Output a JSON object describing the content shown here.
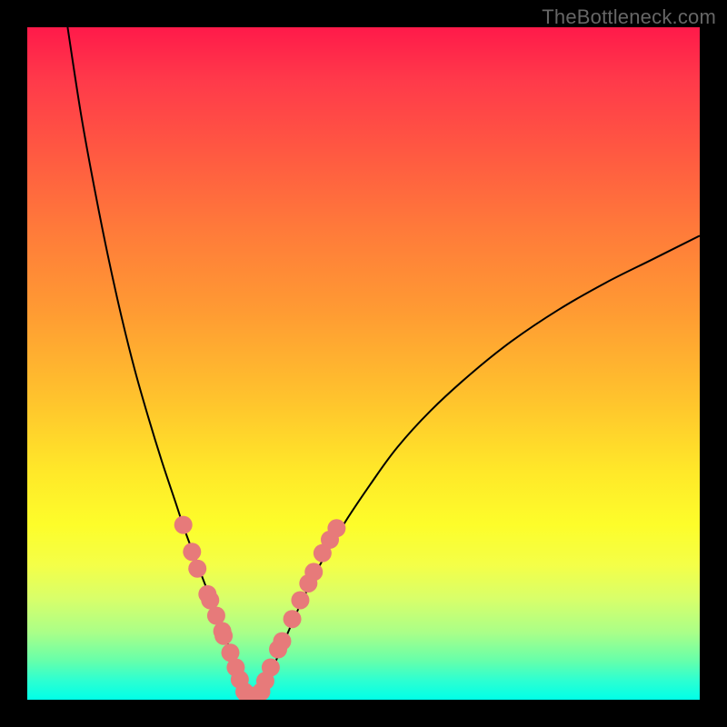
{
  "watermark": "TheBottleneck.com",
  "chart_data": {
    "type": "line",
    "title": "",
    "xlabel": "",
    "ylabel": "",
    "ylim": [
      0,
      100
    ],
    "xlim": [
      0,
      100
    ],
    "series": [
      {
        "name": "curve-left",
        "x": [
          6,
          8,
          10,
          12,
          14,
          16,
          18,
          20,
          22,
          23.5,
          25,
          26.5,
          28,
          29,
          30,
          30.8,
          31.5,
          32.1
        ],
        "values": [
          100,
          87,
          76,
          66,
          57,
          49,
          42,
          35.5,
          29.5,
          25,
          21,
          17,
          13.5,
          10.5,
          7.8,
          5.3,
          3.2,
          1.2
        ]
      },
      {
        "name": "curve-right",
        "x": [
          35,
          36,
          37.5,
          39.2,
          41,
          43.5,
          47,
          51,
          55,
          60,
          66,
          72,
          79,
          86,
          93,
          100
        ],
        "values": [
          1.2,
          3.5,
          7,
          11,
          15,
          20,
          26,
          32,
          37.5,
          43,
          48.5,
          53.3,
          58,
          62,
          65.5,
          69
        ]
      },
      {
        "name": "dots-left",
        "type": "scatter",
        "x": [
          23.2,
          24.5,
          25.3,
          26.8,
          27.2,
          28.1,
          29.0,
          29.2,
          30.2,
          31.0,
          31.6,
          32.3
        ],
        "values": [
          26.0,
          22.0,
          19.5,
          15.7,
          14.8,
          12.5,
          10.2,
          9.5,
          7.0,
          4.8,
          3.0,
          1.2
        ]
      },
      {
        "name": "dots-right",
        "type": "scatter",
        "x": [
          34.8,
          35.4,
          36.2,
          37.3,
          37.9,
          39.4,
          40.6,
          41.8,
          42.6,
          43.9,
          45.0,
          46.0
        ],
        "values": [
          1.2,
          2.8,
          4.8,
          7.5,
          8.7,
          12.0,
          14.8,
          17.3,
          19.0,
          21.8,
          23.8,
          25.5
        ]
      },
      {
        "name": "dots-bottom",
        "type": "scatter",
        "x": [
          32.7,
          33.3,
          33.9,
          34.3
        ],
        "values": [
          0.7,
          0.6,
          0.6,
          0.7
        ]
      }
    ],
    "colors": {
      "curve": "#000000",
      "dots": "#e77a7a"
    }
  }
}
